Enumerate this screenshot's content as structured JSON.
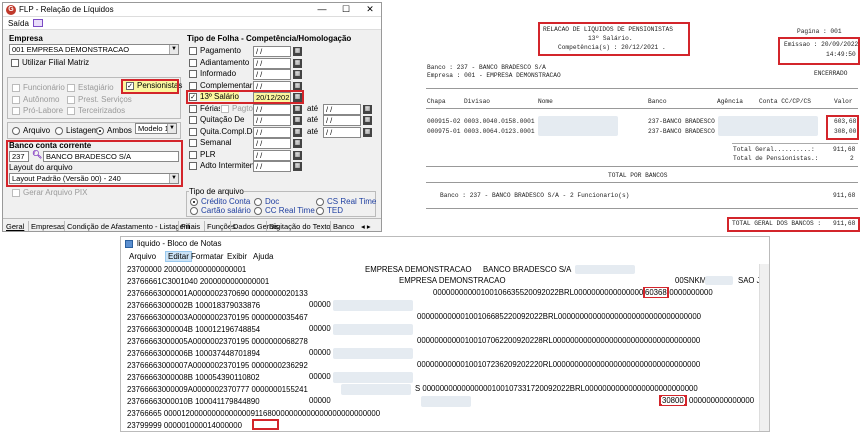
{
  "window": {
    "title": "FLP - Relação de Líquidos",
    "menu_saida": "Saída",
    "close": "✕",
    "minimize": "—",
    "maximize": "☐"
  },
  "empresa": {
    "label": "Empresa",
    "value": "001 EMPRESA DEMONSTRACAO",
    "filial_matriz": "Utilizar Filial Matriz"
  },
  "funcionarios": {
    "funcionario": "Funcionário",
    "estagiario": "Estagiário",
    "pensionistas": "Pensionistas",
    "autonomo": "Autônomo",
    "prest_servicos": "Prest. Serviços",
    "pro_labore": "Pró-Labore",
    "terceirizados": "Terceirizados"
  },
  "saida": {
    "arquivo": "Arquivo",
    "listagem": "Listagem",
    "ambos": "Ambos",
    "modelo": "Modelo 1"
  },
  "banco": {
    "label": "Banco conta corrente",
    "code": "237",
    "name": "BANCO BRADESCO S/A",
    "layout_label": "Layout do arquivo",
    "layout_value": "Layout Padrão (Versão 00) - 240",
    "gerar": "Gerar Arquivo PIX"
  },
  "folha": {
    "header": "Tipo de Folha - Competência/Homologação",
    "items": [
      {
        "label": "Pagamento",
        "date": "/ /",
        "checked": false
      },
      {
        "label": "Adiantamento",
        "date": "/ /",
        "checked": false
      },
      {
        "label": "Informado",
        "date": "/ /",
        "checked": false
      },
      {
        "label": "Complementar",
        "date": "/ /",
        "checked": false
      },
      {
        "label": "13º Salário",
        "date": "20/12/2021",
        "checked": true
      },
      {
        "label": "Férias",
        "date": "/ /",
        "checked": false
      },
      {
        "label": "Quitação De",
        "date": "/ /",
        "checked": false
      },
      {
        "label": "Quita.Compl.De",
        "date": "/ /",
        "checked": false
      },
      {
        "label": "Semanal",
        "date": "/ /",
        "checked": false
      },
      {
        "label": "PLR",
        "date": "/ /",
        "checked": false
      },
      {
        "label": "Adto Intermitente",
        "date": "/ /",
        "checked": false
      }
    ],
    "pagto": "Pagto",
    "ate": "até",
    "ate_date": "/ /"
  },
  "tipo_arquivo": {
    "label": "Tipo de arquivo",
    "credito_conta": "Crédito Conta",
    "doc": "Doc",
    "cs_real_time": "CS Real Time",
    "cartao_salario": "Cartão salário",
    "cc_real_time": "CC Real Time",
    "ted": "TED"
  },
  "tabs": [
    "Geral",
    "Empresas",
    "Condição de Afastamento - Listagem",
    "Filiais",
    "Funções",
    "Dados Gerais",
    "Digitação do Texto",
    "Banco"
  ],
  "report": {
    "title1": "RELACAO DE LIQUIDOS DE PENSIONISTAS",
    "title2": "13º Salário.",
    "title3": "Competência(s) : 20/12/2021 .",
    "pagina": "Pagina : 001",
    "emissao": "Emissao : 20/09/2022",
    "hora": "14:49:50",
    "encerrado": "ENCERRADO",
    "banco_line": "Banco : 237 - BANCO BRADESCO S/A",
    "empresa_line": "Empresa : 001 - EMPRESA DEMONSTRACAO",
    "cols": [
      "Chapa",
      "Divisao",
      "Nome",
      "Banco",
      "Agência",
      "Conta CC/CP/CS",
      "Valor"
    ],
    "rows": [
      {
        "chapa": "000915-02",
        "divisao": "0003.0040.0158.0001",
        "banco": "237-BANCO BRADESCO S",
        "valor": "603,68"
      },
      {
        "chapa": "000975-01",
        "divisao": "0003.0064.0123.0001",
        "banco": "237-BANCO BRADESCO S",
        "valor": "308,00"
      }
    ],
    "total_geral_label": "Total Geral..........:",
    "total_geral": "911,68",
    "total_pens_label": "Total de Pensionistas.:",
    "total_pens": "2",
    "total_por_bancos": "TOTAL POR BANCOS",
    "banco_sum": "Banco : 237 - BANCO BRADESCO S/A - 2 Funcionario(s)",
    "banco_sum_val": "911,68",
    "total_bancos_label": "TOTAL GERAL DOS BANCOS :",
    "total_bancos": "911,68"
  },
  "notepad": {
    "title": "liquido - Bloco de Notas",
    "menu": [
      "Arquivo",
      "Editar",
      "Formatar",
      "Exibir",
      "Ajuda"
    ],
    "lines": [
      "23700000      2000000000000000001",
      "23766661C3001040 2000000000000001",
      "23766663000001A0000002370690 0000000020133",
      "23766663000002B    100018379033876",
      "23766663000003A0000002370195 0000000035467",
      "23766663000004B    100012196748854",
      "23766663000005A0000002370195 0000000068278",
      "23766663000006B    100037448701894",
      "23766663000007A0000002370195 0000000236292",
      "23766663000008B    100054390110802",
      "23766663000009A0000002370777 0000000155241",
      "23766663000010B    100041179844890",
      "23766665        00001200000000000000911680000000000000000000000000",
      "23799999      000001000014000000"
    ],
    "empresa_demo": "EMPRESA DEMONSTRACAO",
    "banco_brad": "BANCO BRADESCO S/A",
    "empresa_demo2": "EMPRESA DEMONSTRACAO",
    "snkm": "00SNKM",
    "sao": "SAO JC",
    "zeros_short": "00000",
    "mid1": "00000000000100106635520092022BRL00000000000000000000000000000000",
    "val1": "60368",
    "mid2": "00000000000100106685220092022BRL000000000000000000000000000000000",
    "mid3": "00000000000100107062200920228RL0000000000000000000000000000000000",
    "mid4": "00000000000100107236209202220RL0000000000000000000000000000000000",
    "mid5": "S 0000000000000000100107331720092022BRL00000000000000000000000000",
    "val2": "30800",
    "tail": "000000000000000",
    "total_val": "911680"
  }
}
